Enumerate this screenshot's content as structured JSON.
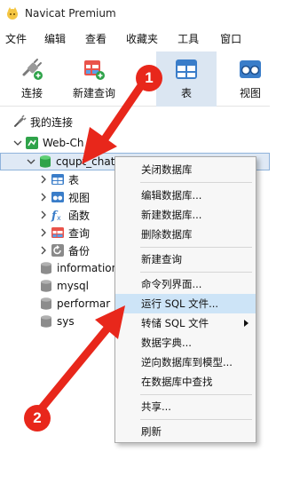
{
  "window": {
    "title": "Navicat Premium"
  },
  "menu": [
    "文件",
    "编辑",
    "查看",
    "收藏夹",
    "工具",
    "窗口"
  ],
  "toolbar": [
    {
      "label": "连接",
      "icon": "plug-connect-icon"
    },
    {
      "label": "新建查询",
      "icon": "new-query-grid-icon"
    },
    {
      "label": "表",
      "icon": "table-icon",
      "active": true
    },
    {
      "label": "视图",
      "icon": "view-glasses-icon"
    }
  ],
  "tree": {
    "my_connections": "我的连接",
    "connection": "Web-Ch",
    "database": "cqupt_chat",
    "children": [
      "表",
      "视图",
      "函数",
      "查询",
      "备份"
    ],
    "other_dbs": [
      "information",
      "mysql",
      "performar",
      "sys"
    ]
  },
  "context_menu": {
    "items": [
      "关闭数据库",
      "编辑数据库...",
      "新建数据库...",
      "删除数据库",
      "新建查询",
      "命令列界面...",
      "运行 SQL 文件...",
      "转储 SQL 文件",
      "数据字典...",
      "逆向数据库到模型...",
      "在数据库中查找",
      "共享...",
      "刷新"
    ],
    "highlighted": "运行 SQL 文件..."
  },
  "annotations": {
    "badge1": "1",
    "badge2": "2"
  },
  "colors": {
    "accent_blue": "#3a7dc9",
    "arrow_red": "#e8271b",
    "db_green": "#2fa34a",
    "highlight": "#cde4f7"
  }
}
